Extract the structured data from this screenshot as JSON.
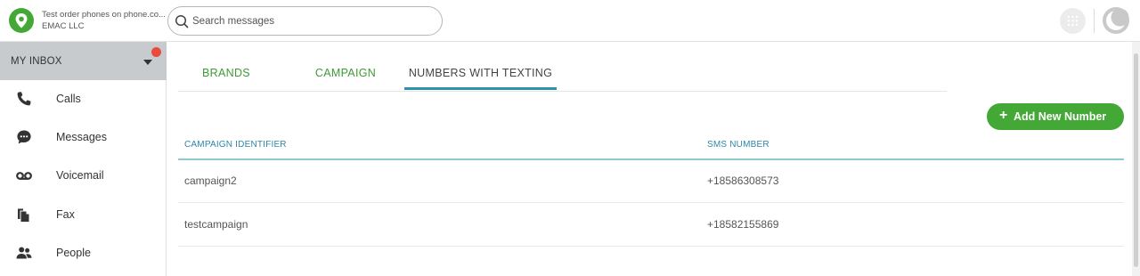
{
  "header": {
    "account_name": "Test order phones on phone.co...",
    "company": "EMAC LLC",
    "logo_icon": "map-pin-icon",
    "search": {
      "placeholder": "Search messages",
      "value": ""
    },
    "apps_icon": "dots-grid-icon",
    "theme_icon": "moon-icon"
  },
  "sidebar": {
    "inbox_label": "MY INBOX",
    "has_notification": true,
    "items": [
      {
        "label": "Calls",
        "icon": "phone-icon"
      },
      {
        "label": "Messages",
        "icon": "chat-bubble-icon"
      },
      {
        "label": "Voicemail",
        "icon": "voicemail-icon"
      },
      {
        "label": "Fax",
        "icon": "fax-document-icon"
      },
      {
        "label": "People",
        "icon": "people-icon"
      }
    ]
  },
  "main": {
    "tabs": [
      {
        "label": "BRANDS",
        "active": false
      },
      {
        "label": "CAMPAIGN",
        "active": false
      },
      {
        "label": "NUMBERS WITH TEXTING",
        "active": true
      }
    ],
    "add_button_label": "Add New Number",
    "table": {
      "columns": [
        "CAMPAIGN IDENTIFIER",
        "SMS NUMBER"
      ],
      "rows": [
        [
          "campaign2",
          "+18586308573"
        ],
        [
          "testcampaign",
          "+18582155869"
        ]
      ]
    }
  },
  "colors": {
    "brand_green": "#43a836",
    "tab_green": "#3f9a36",
    "accent_teal": "#2d93ad",
    "notification_red": "#e84c3d",
    "inbox_bar": "#c8cbcd"
  }
}
